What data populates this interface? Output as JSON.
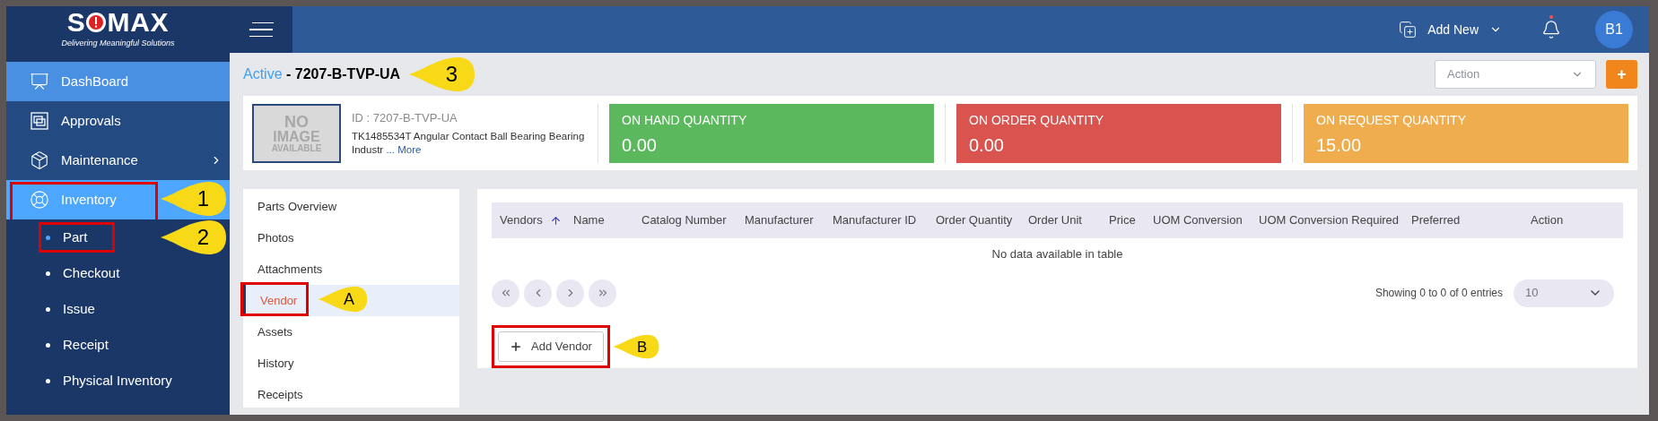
{
  "logo": {
    "lead": "S",
    "rest": "MAX",
    "tagline": "Delivering Meaningful Solutions"
  },
  "sidebar": {
    "items": [
      {
        "label": "DashBoard",
        "selected": true,
        "expanded": false,
        "has_submenu": false
      },
      {
        "label": "Approvals",
        "selected": false,
        "expanded": false,
        "has_submenu": false
      },
      {
        "label": "Maintenance",
        "selected": false,
        "expanded": false,
        "has_submenu": true
      },
      {
        "label": "Inventory",
        "selected": false,
        "expanded": true,
        "has_submenu": false,
        "callout": "1",
        "children": [
          {
            "label": "Part",
            "selected": true,
            "callout": "2"
          },
          {
            "label": "Checkout",
            "selected": false
          },
          {
            "label": "Issue",
            "selected": false
          },
          {
            "label": "Receipt",
            "selected": false
          },
          {
            "label": "Physical Inventory",
            "selected": false
          }
        ]
      }
    ]
  },
  "header": {
    "add_new": "Add New",
    "notification": true,
    "avatar": "B1"
  },
  "title": {
    "status": "Active",
    "separator": " - ",
    "part_id": "7207-B-TVP-UA",
    "callout": "3"
  },
  "action_select": {
    "placeholder": "Action"
  },
  "add_button": "+",
  "part": {
    "image_text": [
      "NO",
      "IMAGE",
      "AVAILABLE"
    ],
    "id_line": "ID : 7207-B-TVP-UA",
    "description": "TK1485534T Angular Contact Ball Bearing Bearing Industr",
    "more_link": "... More"
  },
  "quantities": [
    {
      "label": "ON HAND QUANTITY",
      "value": "0.00",
      "color": "#5cb85c"
    },
    {
      "label": "ON ORDER QUANTITY",
      "value": "0.00",
      "color": "#d9534f"
    },
    {
      "label": "ON REQUEST QUANTITY",
      "value": "15.00",
      "color": "#f0ad4e"
    }
  ],
  "tabs": [
    {
      "label": "Parts Overview",
      "selected": false
    },
    {
      "label": "Photos",
      "selected": false
    },
    {
      "label": "Attachments",
      "selected": false
    },
    {
      "label": "Vendor",
      "selected": true,
      "callout": "A"
    },
    {
      "label": "Assets",
      "selected": false
    },
    {
      "label": "History",
      "selected": false
    },
    {
      "label": "Receipts",
      "selected": false
    }
  ],
  "table": {
    "columns": [
      {
        "label": "Vendors",
        "sorted": true
      },
      {
        "label": "Name",
        "sorted": false
      },
      {
        "label": "Catalog Number",
        "sorted": false
      },
      {
        "label": "Manufacturer",
        "sorted": false
      },
      {
        "label": "Manufacturer ID",
        "sorted": false
      },
      {
        "label": "Order Quantity",
        "sorted": false
      },
      {
        "label": "Order Unit",
        "sorted": false
      },
      {
        "label": "Price",
        "sorted": false
      },
      {
        "label": "UOM Conversion",
        "sorted": false
      },
      {
        "label": "UOM Conversion Required",
        "sorted": false
      },
      {
        "label": "Preferred",
        "sorted": false
      },
      {
        "label": "Action",
        "sorted": false
      }
    ],
    "empty_message": "No data available in table",
    "info": "Showing 0 to 0 of 0 entries",
    "page_size": "10"
  },
  "add_vendor": {
    "label": "Add Vendor",
    "callout": "B"
  }
}
